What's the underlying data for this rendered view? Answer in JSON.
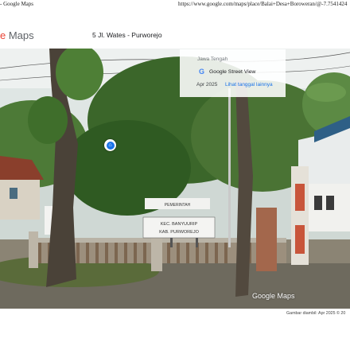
{
  "print_header": {
    "title": "- Google Maps",
    "url": "https://www.google.com/maps/place/Balai+Desa+Boroweran/@-7.7541424"
  },
  "brand": {
    "first_letter": "e",
    "rest": " Maps"
  },
  "address": "5 Jl. Wates - Purworejo",
  "street_view_card": {
    "region": "Jawa Tengah",
    "label": "Google Street View",
    "date": "Apr 2025",
    "other_dates_link": "Lihat tanggal lainnya"
  },
  "photo_signs": {
    "sign_line_1": "PEMERINTAH",
    "sign_line_2": "KEC. BANYUURIP",
    "sign_line_3": "KAB. PURWOREJO"
  },
  "icons": {
    "google_g": "google-g-icon",
    "pin": "street-view-location-pin-icon"
  },
  "watermark": "Google Maps",
  "footer": "Gambar diambil: Apr 2025   © 20",
  "colors": {
    "link": "#1a73e8",
    "brand_red": "#ea4335",
    "sky": "#d7e2e0",
    "foliage": "#3f6b2c"
  }
}
